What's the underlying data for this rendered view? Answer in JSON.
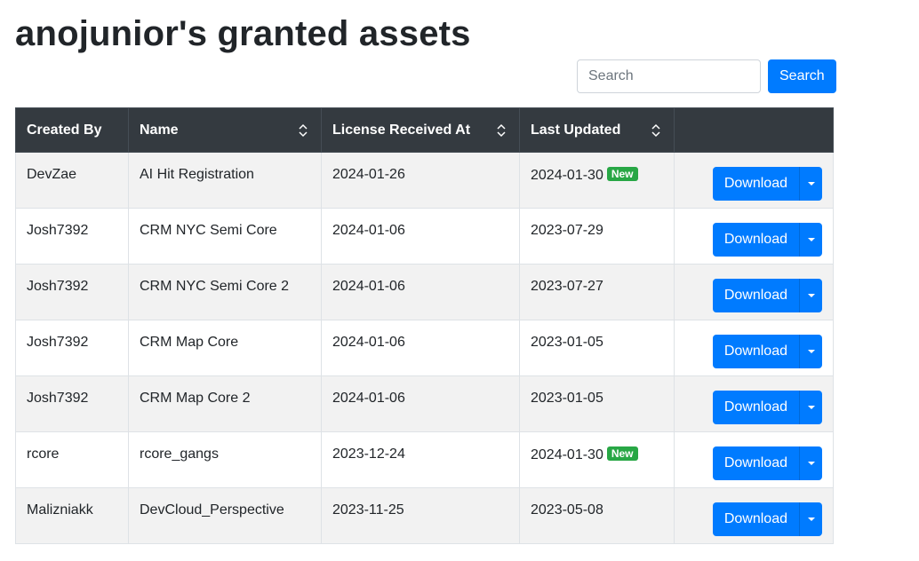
{
  "page": {
    "title": "anojunior's granted assets"
  },
  "search": {
    "placeholder": "Search",
    "button_label": "Search"
  },
  "table": {
    "columns": [
      {
        "label": "Created By",
        "sortable": false
      },
      {
        "label": "Name",
        "sortable": true
      },
      {
        "label": "License Received At",
        "sortable": true
      },
      {
        "label": "Last Updated",
        "sortable": true
      },
      {
        "label": "",
        "sortable": false
      }
    ],
    "rows": [
      {
        "created_by": "DevZae",
        "name": "AI Hit Registration",
        "license_received_at": "2024-01-26",
        "last_updated": "2024-01-30",
        "is_new": true,
        "action": "Download"
      },
      {
        "created_by": "Josh7392",
        "name": "CRM NYC Semi Core",
        "license_received_at": "2024-01-06",
        "last_updated": "2023-07-29",
        "is_new": false,
        "action": "Download"
      },
      {
        "created_by": "Josh7392",
        "name": "CRM NYC Semi Core 2",
        "license_received_at": "2024-01-06",
        "last_updated": "2023-07-27",
        "is_new": false,
        "action": "Download"
      },
      {
        "created_by": "Josh7392",
        "name": "CRM Map Core",
        "license_received_at": "2024-01-06",
        "last_updated": "2023-01-05",
        "is_new": false,
        "action": "Download"
      },
      {
        "created_by": "Josh7392",
        "name": "CRM Map Core 2",
        "license_received_at": "2024-01-06",
        "last_updated": "2023-01-05",
        "is_new": false,
        "action": "Download"
      },
      {
        "created_by": "rcore",
        "name": "rcore_gangs",
        "license_received_at": "2023-12-24",
        "last_updated": "2024-01-30",
        "is_new": true,
        "action": "Download"
      },
      {
        "created_by": "Malizniakk",
        "name": "DevCloud_Perspective",
        "license_received_at": "2023-11-25",
        "last_updated": "2023-05-08",
        "is_new": false,
        "action": "Download"
      }
    ],
    "new_badge_label": "New"
  },
  "colors": {
    "primary": "#007bff",
    "header_bg": "#343a40",
    "badge_success": "#28a745",
    "stripe": "#f2f2f2"
  },
  "icons": {
    "sort": "sort-up-down-icon",
    "dropdown": "caret-down-icon"
  }
}
